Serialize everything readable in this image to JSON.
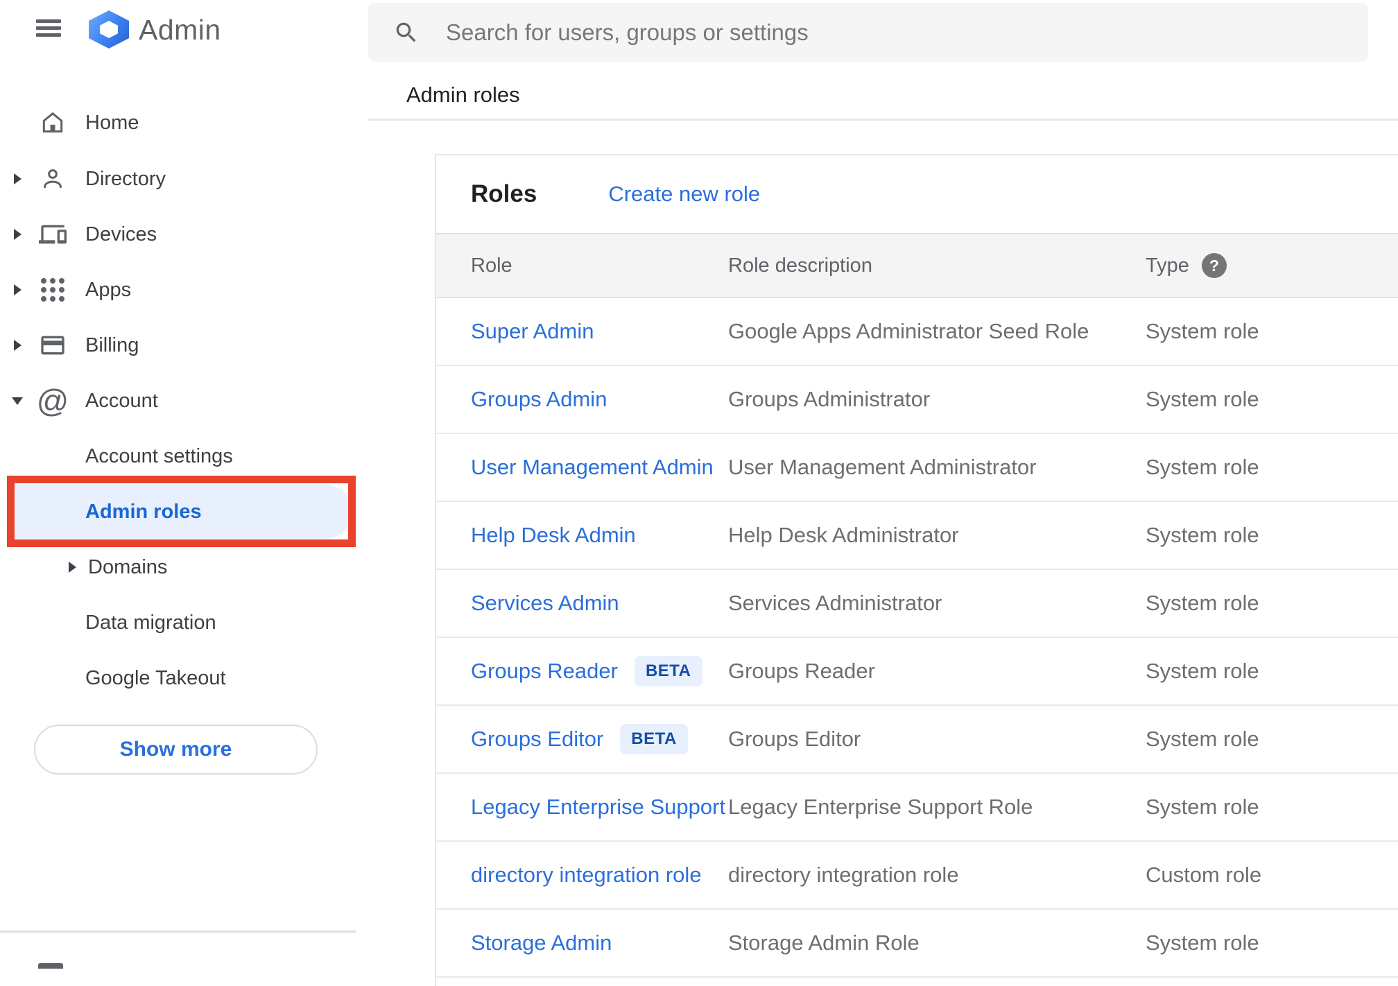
{
  "app": {
    "title": "Admin"
  },
  "search": {
    "placeholder": "Search for users, groups or settings"
  },
  "breadcrumb": "Admin roles",
  "sidebar": {
    "items": {
      "home": "Home",
      "directory": "Directory",
      "devices": "Devices",
      "apps": "Apps",
      "billing": "Billing",
      "account": "Account"
    },
    "account_children": {
      "account_settings": "Account settings",
      "admin_roles": "Admin roles",
      "domains": "Domains",
      "data_migration": "Data migration",
      "google_takeout": "Google Takeout"
    },
    "selected_item": "Admin roles",
    "show_more": "Show more"
  },
  "panel": {
    "title": "Roles",
    "create_link": "Create new role"
  },
  "table": {
    "headers": {
      "role": "Role",
      "description": "Role description",
      "type": "Type"
    },
    "help_icon": "?",
    "rows": [
      {
        "role": "Super Admin",
        "description": "Google Apps Administrator Seed Role",
        "type": "System role"
      },
      {
        "role": "Groups Admin",
        "description": "Groups Administrator",
        "type": "System role"
      },
      {
        "role": "User Management Admin",
        "description": "User Management Administrator",
        "type": "System role"
      },
      {
        "role": "Help Desk Admin",
        "description": "Help Desk Administrator",
        "type": "System role"
      },
      {
        "role": "Services Admin",
        "description": "Services Administrator",
        "type": "System role"
      },
      {
        "role": "Groups Reader",
        "beta_label": "BETA",
        "description": "Groups Reader",
        "type": "System role"
      },
      {
        "role": "Groups Editor",
        "beta_label": "BETA",
        "description": "Groups Editor",
        "type": "System role"
      },
      {
        "role": "Legacy Enterprise Support",
        "description": "Legacy Enterprise Support Role",
        "type": "System role"
      },
      {
        "role": "directory integration role",
        "description": "directory integration role",
        "type": "Custom role"
      },
      {
        "role": "Storage Admin",
        "description": "Storage Admin Role",
        "type": "System role"
      }
    ]
  },
  "colors": {
    "link_blue": "#2a6fdb",
    "selected_blue": "#1967d2",
    "selected_bg": "#e8f0fe",
    "annotation_red": "#e8432c",
    "beta_text": "#174ea6",
    "icon_gray": "#5f6368"
  }
}
